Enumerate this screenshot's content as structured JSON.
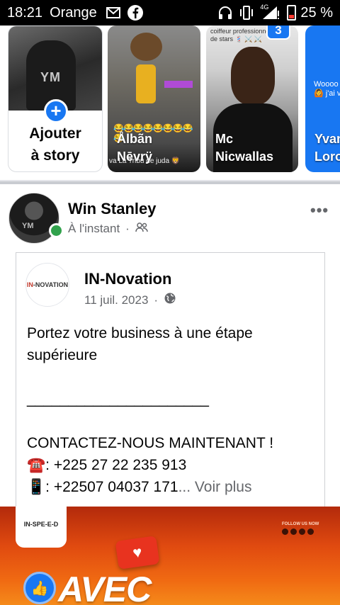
{
  "status_bar": {
    "time": "18:21",
    "carrier": "Orange",
    "network": "4G",
    "battery": "25 %",
    "icons": [
      "gmail-icon",
      "facebook-icon",
      "headphones-icon",
      "vibrate-icon",
      "signal-icon",
      "battery-icon"
    ]
  },
  "stories": {
    "add": {
      "label_line1": "Ajouter",
      "label_line2": "à story",
      "thumb_text": "YM"
    },
    "items": [
      {
        "name_line1": "Ålbãn",
        "name_line2": "Nēvrÿ",
        "badge": "",
        "emojis": "😂😂😂😂😂😂😂😂😂",
        "caption": "va         La Tribu de juda 🦁"
      },
      {
        "name_line1": "Mc",
        "name_line2": "Nicwallas",
        "badge": "3",
        "top_text": "coiffeur professionnel\nde stars 💈 ⚔️ ⚔️"
      },
      {
        "name_line1": "Yvan",
        "name_line2": "Loro",
        "txt": "Woooo\n🙆 j'ai v"
      }
    ]
  },
  "post": {
    "author": "Win Stanley",
    "time": "À l'instant",
    "more": "•••",
    "avatar_text": "YM",
    "shared": {
      "page_name": "IN-Novation",
      "logo_text_a": "IN",
      "logo_text_b": "-NOVATION",
      "date": "11 juil. 2023",
      "text": "Portez votre business à une étape supérieure\n\n______________________\n\nCONTACTEZ-NOUS MAINTENANT !\n☎️: +225 27 22 235 913\n📱: +22507 04037 171",
      "see_more": "... Voir plus"
    },
    "banner": {
      "logo_text": "IN-SPE-E-D",
      "follow_text": "FOLLOW US NOW",
      "headline": "AVEC"
    }
  },
  "colors": {
    "accent": "#1877f2",
    "online": "#31a24c",
    "banner_orange": "#e04a10"
  }
}
